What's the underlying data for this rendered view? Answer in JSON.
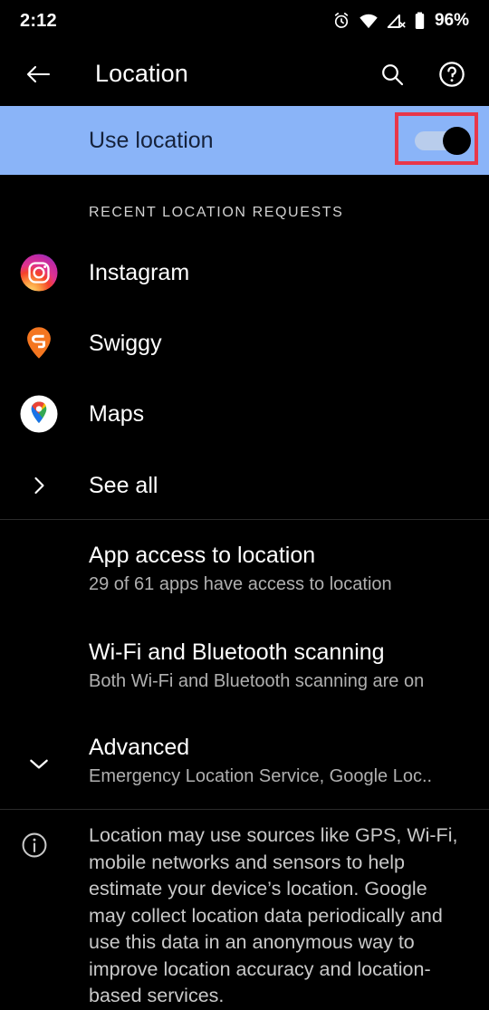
{
  "status_bar": {
    "time": "2:12",
    "battery_percent": "96%",
    "icons": [
      "alarm-icon",
      "wifi-icon",
      "cellular-no-signal-icon",
      "battery-icon"
    ]
  },
  "app_bar": {
    "back_icon": "arrow-back-icon",
    "title": "Location",
    "search_icon": "search-icon",
    "help_icon": "help-circle-icon"
  },
  "master_switch": {
    "label": "Use location",
    "state": "on",
    "track_color": "#b9cdec",
    "thumb_color": "#000000",
    "row_background": "#8ab4f8",
    "row_text_color": "#15223b",
    "highlight_color": "#e8374a"
  },
  "recent_section": {
    "header": "RECENT LOCATION REQUESTS",
    "apps": [
      {
        "name": "Instagram",
        "icon": "instagram-icon"
      },
      {
        "name": "Swiggy",
        "icon": "swiggy-icon"
      },
      {
        "name": "Maps",
        "icon": "google-maps-icon"
      }
    ],
    "see_all": {
      "label": "See all",
      "icon": "chevron-right-icon"
    }
  },
  "settings": [
    {
      "title": "App access to location",
      "subtitle": "29 of 61 apps have access to location"
    },
    {
      "title": "Wi-Fi and Bluetooth scanning",
      "subtitle": "Both Wi-Fi and Bluetooth scanning are on"
    },
    {
      "title": "Advanced",
      "subtitle": "Emergency Location Service, Google Loc..",
      "icon": "chevron-down-icon"
    }
  ],
  "footer": {
    "icon": "info-icon",
    "text": "Location may use sources like GPS, Wi-Fi, mobile networks and sensors to help estimate your device’s location. Google may collect location data periodically and use this data in an anonymous way to improve location accuracy and location-based services."
  }
}
